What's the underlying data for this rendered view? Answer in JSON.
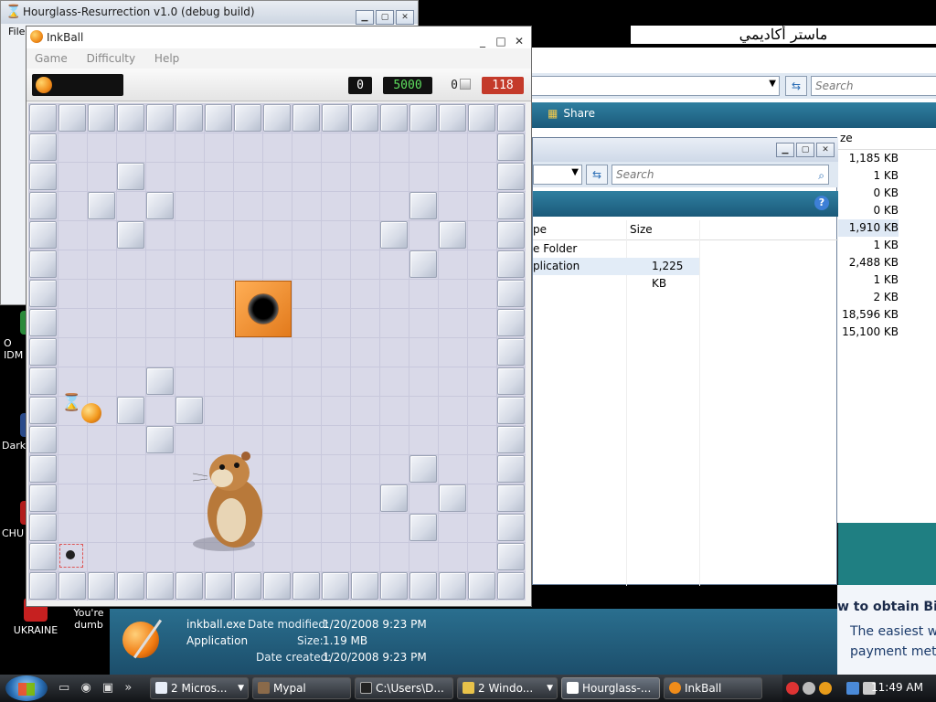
{
  "desktop": {
    "banner_text": "ماستر أكاديمي",
    "icons": [
      {
        "label": "O\nIDM"
      },
      {
        "label": "Dark"
      },
      {
        "label": "CHU"
      },
      {
        "label": "UKRAINE"
      },
      {
        "label": "You're\ndumb"
      }
    ]
  },
  "hourglass": {
    "title": "Hourglass-Resurrection v1.0 (debug build)",
    "menu_label": "File"
  },
  "inkball": {
    "title": "InkBall",
    "menu": [
      "Game",
      "Difficulty",
      "Help"
    ],
    "score_left": "0",
    "score_main": "5000",
    "balls_lost": "0",
    "timer": "118"
  },
  "explorer_back": {
    "search_placeholder": "Search",
    "share_label": "Share",
    "size_header": "ze",
    "sizes": [
      "1,185 KB",
      "1 KB",
      "0 KB",
      "0 KB",
      "1,910 KB",
      "1 KB",
      "2,488 KB",
      "1 KB",
      "2 KB",
      "18,596 KB",
      "15,100 KB"
    ],
    "obtain_heading": "w to obtain Bit",
    "obtain_line1": "The easiest wa",
    "obtain_line2": "payment meth"
  },
  "explorer_front": {
    "search_placeholder": "Search",
    "col_type": "pe",
    "col_size": "Size",
    "rows": [
      {
        "type": "e Folder",
        "size": ""
      },
      {
        "type": "plication",
        "size": "1,225 KB"
      }
    ]
  },
  "preview": {
    "filename": "inkball.exe",
    "type": "Application",
    "modified_label": "Date modified:",
    "modified_value": "1/20/2008 9:23 PM",
    "size_label": "Size:",
    "size_value": "1.19 MB",
    "created_label": "Date created:",
    "created_value": "1/20/2008 9:23 PM"
  },
  "taskbar": {
    "buttons": [
      {
        "label": "2 Micros...",
        "has_arrow": true
      },
      {
        "label": "Mypal",
        "has_arrow": false
      },
      {
        "label": "C:\\Users\\D...",
        "has_arrow": false
      },
      {
        "label": "2 Windo...",
        "has_arrow": true
      },
      {
        "label": "Hourglass-...",
        "has_arrow": false
      },
      {
        "label": "InkBall",
        "has_arrow": false
      }
    ],
    "clock": "11:49 AM"
  },
  "colors": {
    "timer_bg": "#c43a2a",
    "score_green": "#5fe05f",
    "preview_bg": "#1c4e6b"
  }
}
